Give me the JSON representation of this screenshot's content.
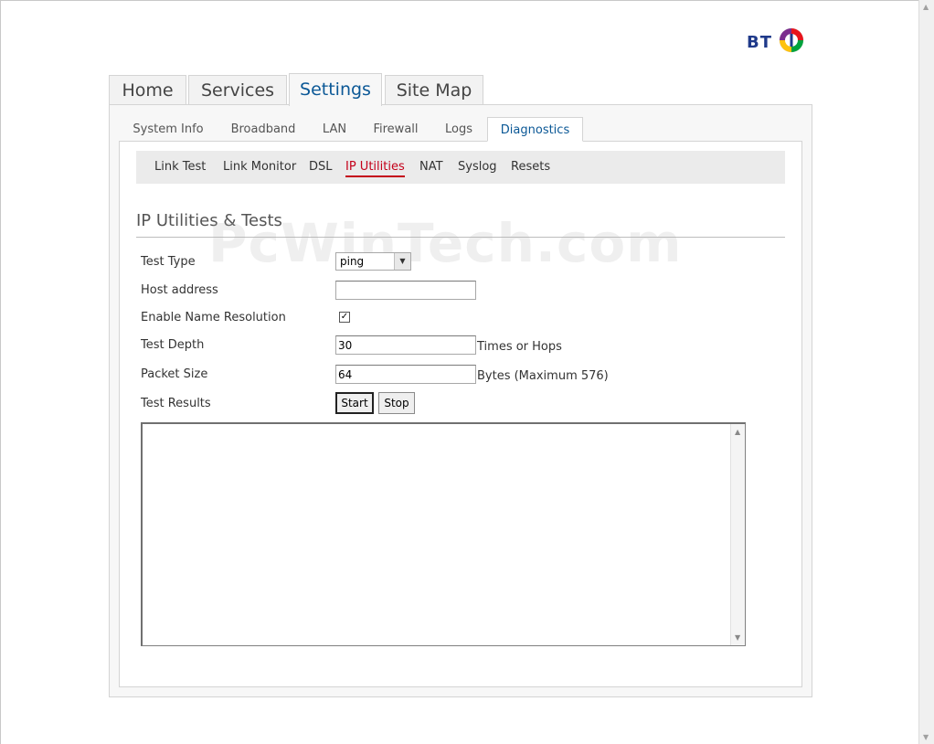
{
  "brand": {
    "logo_text": "BT"
  },
  "main_tabs": [
    {
      "label": "Home"
    },
    {
      "label": "Services"
    },
    {
      "label": "Settings",
      "active": true
    },
    {
      "label": "Site Map"
    }
  ],
  "sub_tabs": [
    {
      "label": "System Info"
    },
    {
      "label": "Broadband"
    },
    {
      "label": "LAN"
    },
    {
      "label": "Firewall"
    },
    {
      "label": "Logs"
    },
    {
      "label": "Diagnostics",
      "active": true
    }
  ],
  "tertiary_nav": [
    {
      "label": "Link Test"
    },
    {
      "label": "Link Monitor"
    },
    {
      "label": "DSL"
    },
    {
      "label": "IP Utilities",
      "active": true
    },
    {
      "label": "NAT"
    },
    {
      "label": "Syslog"
    },
    {
      "label": "Resets"
    }
  ],
  "watermark": "PcWinTech.com",
  "section_title": "IP Utilities & Tests",
  "form": {
    "test_type": {
      "label": "Test Type",
      "value": "ping"
    },
    "host_address": {
      "label": "Host address",
      "value": ""
    },
    "enable_name_resolution": {
      "label": "Enable Name Resolution",
      "checked": true,
      "check_glyph": "✓"
    },
    "test_depth": {
      "label": "Test Depth",
      "value": "30",
      "suffix": "Times or Hops"
    },
    "packet_size": {
      "label": "Packet Size",
      "value": "64",
      "suffix": "Bytes (Maximum 576)"
    },
    "test_results": {
      "label": "Test Results",
      "output": ""
    }
  },
  "buttons": {
    "start": "Start",
    "stop": "Stop"
  },
  "icons": {
    "dropdown": "chevron-down-icon",
    "scroll_up": "scroll-up-arrow-icon",
    "scroll_down": "scroll-down-arrow-icon"
  },
  "colors": {
    "brand_blue": "#0b5896",
    "active_red": "#c4001a",
    "logo_navy": "#1f3a8a"
  }
}
